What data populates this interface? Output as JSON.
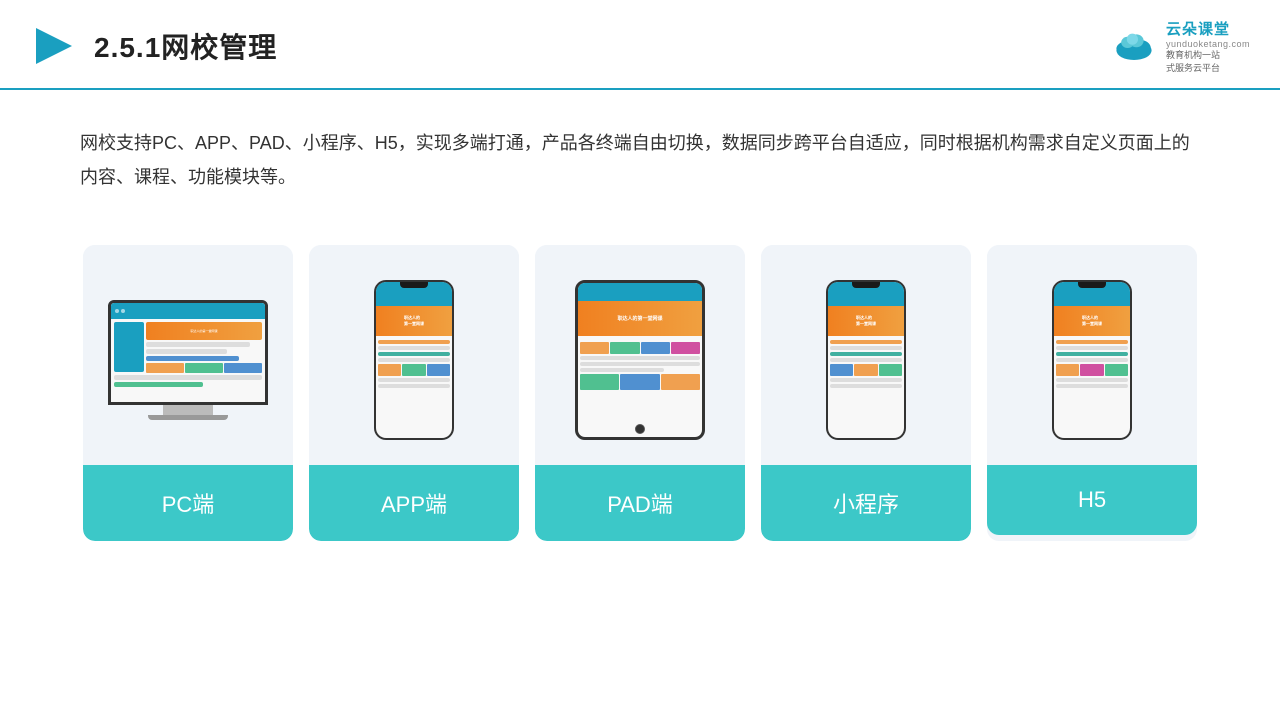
{
  "header": {
    "title": "2.5.1网校管理",
    "logo_main": "云朵课堂",
    "logo_url": "yunduoketang.com",
    "logo_slogan": "教育机构一站\n式服务云平台"
  },
  "description": {
    "text": "网校支持PC、APP、PAD、小程序、H5，实现多端打通，产品各终端自由切换，数据同步跨平台自适应，同时根据机构需求自定义页面上的内容、课程、功能模块等。"
  },
  "cards": [
    {
      "id": "pc",
      "label": "PC端"
    },
    {
      "id": "app",
      "label": "APP端"
    },
    {
      "id": "pad",
      "label": "PAD端"
    },
    {
      "id": "miniprogram",
      "label": "小程序"
    },
    {
      "id": "h5",
      "label": "H5"
    }
  ]
}
